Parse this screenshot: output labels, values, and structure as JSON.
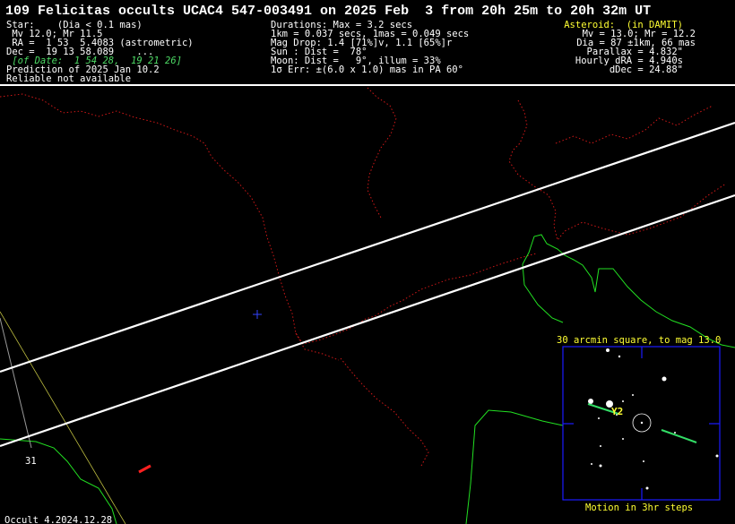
{
  "title": "109 Felicitas occults UCAC4 547-003491 on 2025 Feb  3 from 20h 25m to 20h 32m UT",
  "star": {
    "line1": "Star:    (Dia < 0.1 mas)",
    "line2": " Mv 12.0; Mr 11.5",
    "line3": " RA =  1 53  5.4083 (astrometric)",
    "line4": "Dec =  19 13 58.089    ...",
    "line5": " [of Date:  1 54 28,  19 21 26]",
    "line6": "Prediction of 2025 Jan 10.2",
    "line7": "Reliable not available"
  },
  "event": {
    "line1": "Durations: Max = 3.2 secs",
    "line2": "1km = 0.037 secs, 1mas = 0.049 secs",
    "line3": "Mag Drop: 1.4 [71%]v, 1.1 [65%]r",
    "line4": "Sun : Dist =  78°",
    "line5": "Moon: Dist =   9°, illum = 33%",
    "line6": "1σ Err: ±(6.0 x 1.0) mas in PA 60°"
  },
  "asteroid": {
    "line1": "Asteroid:  (in DAMIT)",
    "line2": "Mv = 13.0; Mr = 12.2",
    "line3": "Dia = 87 ±1km, 66 mas",
    "line4": "Parallax = 4.832\"",
    "line5": "Hourly dRA = 4.940s",
    "line6": "dDec = 24.88\""
  },
  "map": {
    "longitude_label": "31",
    "software": "Occult 4.2024.12.28"
  },
  "finder": {
    "title": "30 arcmin square, to mag 13.0",
    "caption": "Motion in 3hr steps",
    "marker": "Y2"
  },
  "colors": {
    "path": "#ffffff",
    "coast": "#22e022",
    "border": "#d01818",
    "highlight": "#ffff33",
    "finder_frame": "#1a1aff"
  }
}
